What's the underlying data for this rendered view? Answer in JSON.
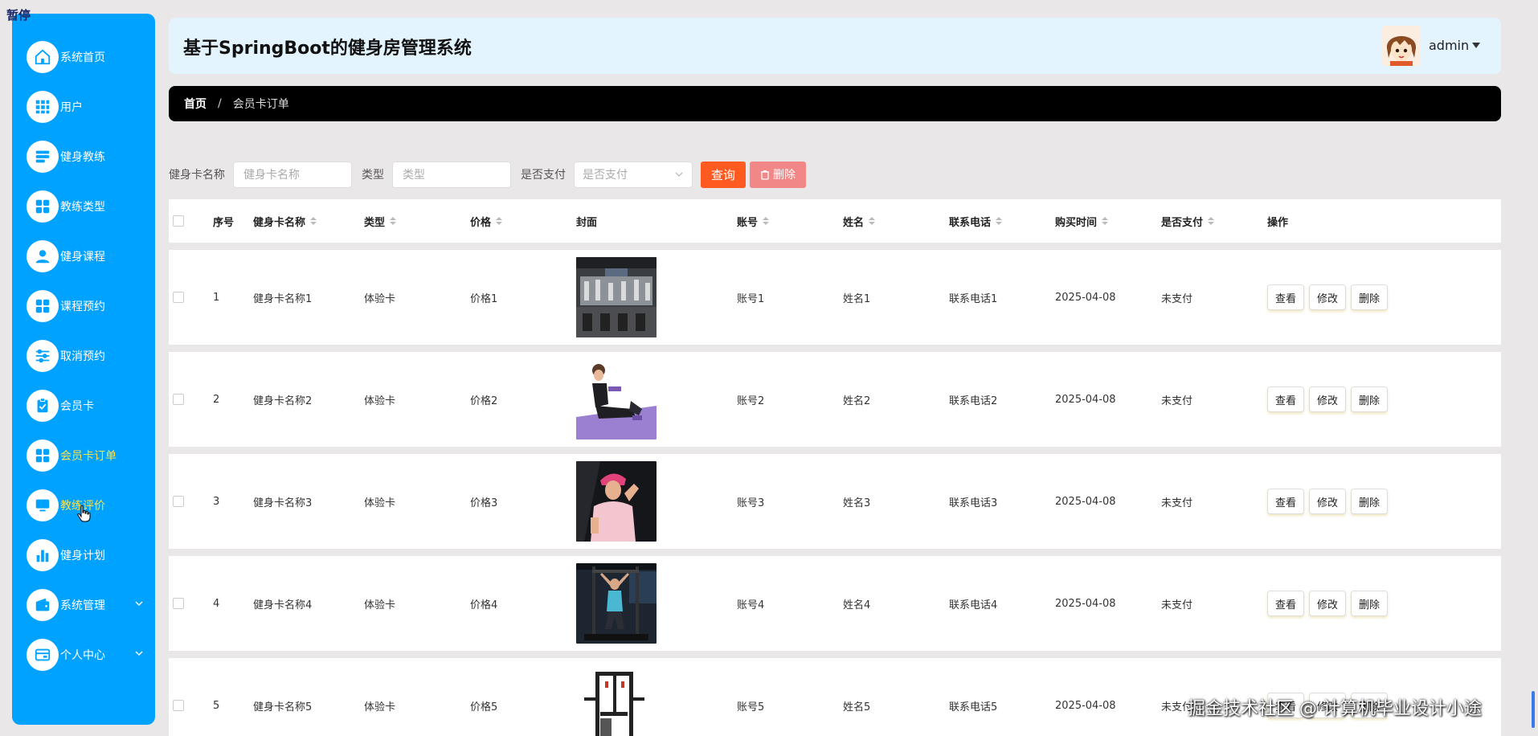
{
  "overlay": {
    "pause_label": "暂停",
    "watermark": "掘金技术社区 @ 计算机毕业设计小途"
  },
  "sidebar": {
    "items": [
      {
        "label": "系统首页",
        "icon": "home-icon"
      },
      {
        "label": "用户",
        "icon": "grid-icon"
      },
      {
        "label": "健身教练",
        "icon": "list-icon"
      },
      {
        "label": "教练类型",
        "icon": "apps-icon"
      },
      {
        "label": "健身课程",
        "icon": "person-icon"
      },
      {
        "label": "课程预约",
        "icon": "apps-icon"
      },
      {
        "label": "取消预约",
        "icon": "sliders-icon"
      },
      {
        "label": "会员卡",
        "icon": "clipboard-check-icon"
      },
      {
        "label": "会员卡订单",
        "icon": "apps-icon",
        "active": true
      },
      {
        "label": "教练评价",
        "icon": "monitor-icon"
      },
      {
        "label": "健身计划",
        "icon": "bar-chart-icon"
      },
      {
        "label": "系统管理",
        "icon": "wallet-icon",
        "expandable": true
      },
      {
        "label": "个人中心",
        "icon": "card-icon",
        "expandable": true
      }
    ]
  },
  "header": {
    "title": "基于SpringBoot的健身房管理系统",
    "user": "admin"
  },
  "breadcrumb": {
    "home": "首页",
    "separator": "/",
    "current": "会员卡订单"
  },
  "search": {
    "name_label": "健身卡名称",
    "name_placeholder": "健身卡名称",
    "type_label": "类型",
    "type_placeholder": "类型",
    "paid_label": "是否支付",
    "paid_placeholder": "是否支付",
    "query_button": "查询",
    "delete_button": "删除"
  },
  "table": {
    "headers": {
      "index": "序号",
      "name": "健身卡名称",
      "type": "类型",
      "price": "价格",
      "cover": "封面",
      "account": "账号",
      "uname": "姓名",
      "phone": "联系电话",
      "time": "购买时间",
      "paid": "是否支付",
      "ops": "操作"
    },
    "op_labels": {
      "view": "查看",
      "edit": "修改",
      "delete": "删除"
    },
    "rows": [
      {
        "index": "1",
        "name": "健身卡名称1",
        "type": "体验卡",
        "price": "价格1",
        "account": "账号1",
        "uname": "姓名1",
        "phone": "联系电话1",
        "time": "2025-04-08",
        "paid": "未支付"
      },
      {
        "index": "2",
        "name": "健身卡名称2",
        "type": "体验卡",
        "price": "价格2",
        "account": "账号2",
        "uname": "姓名2",
        "phone": "联系电话2",
        "time": "2025-04-08",
        "paid": "未支付"
      },
      {
        "index": "3",
        "name": "健身卡名称3",
        "type": "体验卡",
        "price": "价格3",
        "account": "账号3",
        "uname": "姓名3",
        "phone": "联系电话3",
        "time": "2025-04-08",
        "paid": "未支付"
      },
      {
        "index": "4",
        "name": "健身卡名称4",
        "type": "体验卡",
        "price": "价格4",
        "account": "账号4",
        "uname": "姓名4",
        "phone": "联系电话4",
        "time": "2025-04-08",
        "paid": "未支付"
      },
      {
        "index": "5",
        "name": "健身卡名称5",
        "type": "体验卡",
        "price": "价格5",
        "account": "账号5",
        "uname": "姓名5",
        "phone": "联系电话5",
        "time": "2025-04-08",
        "paid": "未支付"
      }
    ]
  },
  "colors": {
    "sidebar": "#00a2ff",
    "active_label": "#ffe24a",
    "query_button": "#ff5a1f",
    "delete_button": "#f28787",
    "header_bg": "#e3f4ff"
  }
}
